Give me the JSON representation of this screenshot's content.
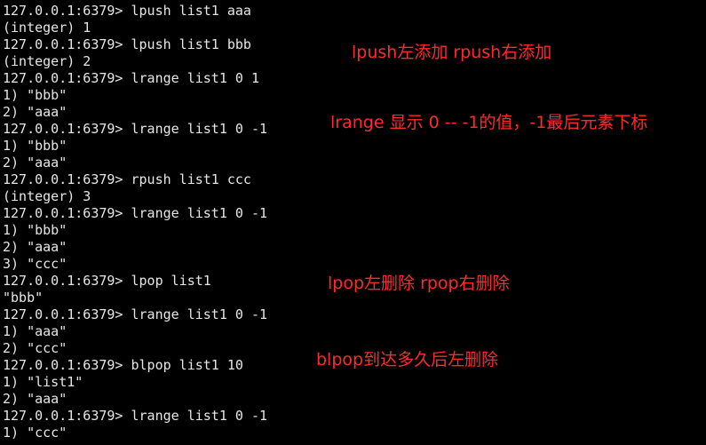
{
  "terminal": {
    "lines": [
      "127.0.0.1:6379> lpush list1 aaa",
      "(integer) 1",
      "127.0.0.1:6379> lpush list1 bbb",
      "(integer) 2",
      "127.0.0.1:6379> lrange list1 0 1",
      "1) \"bbb\"",
      "2) \"aaa\"",
      "127.0.0.1:6379> lrange list1 0 -1",
      "1) \"bbb\"",
      "2) \"aaa\"",
      "127.0.0.1:6379> rpush list1 ccc",
      "(integer) 3",
      "127.0.0.1:6379> lrange list1 0 -1",
      "1) \"bbb\"",
      "2) \"aaa\"",
      "3) \"ccc\"",
      "127.0.0.1:6379> lpop list1",
      "\"bbb\"",
      "127.0.0.1:6379> lrange list1 0 -1",
      "1) \"aaa\"",
      "2) \"ccc\"",
      "127.0.0.1:6379> blpop list1 10",
      "1) \"list1\"",
      "2) \"aaa\"",
      "127.0.0.1:6379> lrange list1 0 -1",
      "1) \"ccc\""
    ]
  },
  "annotations": {
    "push": "lpush左添加 rpush右添加",
    "lrange": "lrange 显示 0 -- -1的值，-1最后元素下标",
    "pop": "lpop左删除 rpop右删除",
    "blpop": "blpop到达多久后左删除"
  },
  "colors": {
    "background": "#000000",
    "text": "#e6e6e6",
    "annotation": "#ff2a2a"
  }
}
